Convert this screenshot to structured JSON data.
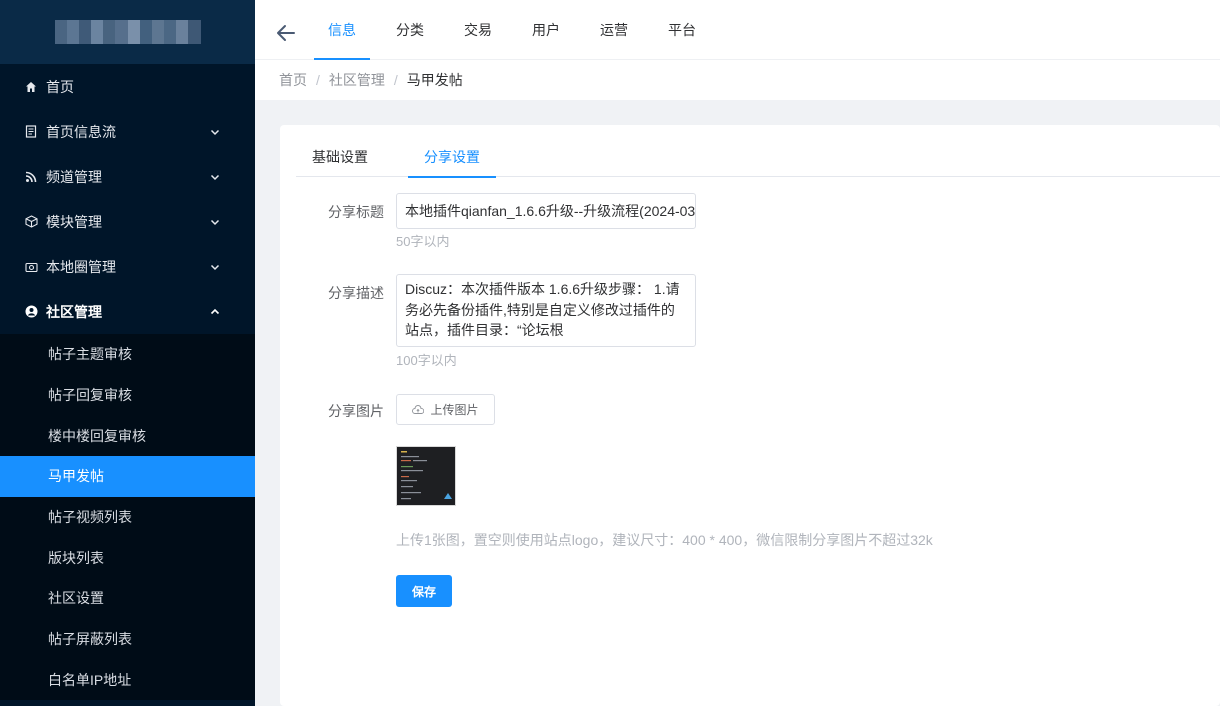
{
  "sidebar": {
    "logo_text": "",
    "items": [
      {
        "label": "首页",
        "icon": "home-icon"
      },
      {
        "label": "首页信息流",
        "icon": "document-icon"
      },
      {
        "label": "频道管理",
        "icon": "rss-icon"
      },
      {
        "label": "模块管理",
        "icon": "cube-icon"
      },
      {
        "label": "本地圈管理",
        "icon": "camera-icon"
      },
      {
        "label": "社区管理",
        "icon": "user-circle-icon"
      }
    ],
    "community_subitems": [
      "帖子主题审核",
      "帖子回复审核",
      "楼中楼回复审核",
      "马甲发帖",
      "帖子视频列表",
      "版块列表",
      "社区设置",
      "帖子屏蔽列表",
      "白名单IP地址"
    ],
    "active_subitem": "马甲发帖"
  },
  "topnav": {
    "back_icon": "arrow-left-icon",
    "tabs": [
      "信息",
      "分类",
      "交易",
      "用户",
      "运营",
      "平台"
    ],
    "active_tab": "信息"
  },
  "breadcrumb": [
    "首页",
    "社区管理",
    "马甲发帖"
  ],
  "card": {
    "tabs": [
      "基础设置",
      "分享设置"
    ],
    "active_tab": "分享设置",
    "share_title": {
      "label": "分享标题",
      "value": "本地插件qianfan_1.6.6升级--升级流程(2024-03",
      "hint": "50字以内"
    },
    "share_desc": {
      "label": "分享描述",
      "value": "Discuz：本次插件版本 1.6.6升级步骤： 1.请务必先备份插件,特别是自定义修改过插件的站点，插件目录：“论坛根",
      "hint": "100字以内"
    },
    "share_image": {
      "label": "分享图片",
      "upload_label": "上传图片",
      "hint": "上传1张图，置空则使用站点logo，建议尺寸：400 * 400，微信限制分享图片不超过32k"
    },
    "save_label": "保存"
  },
  "colors": {
    "accent": "#1890ff",
    "sidebar_bg": "#001529",
    "submenu_bg": "#000c17"
  }
}
